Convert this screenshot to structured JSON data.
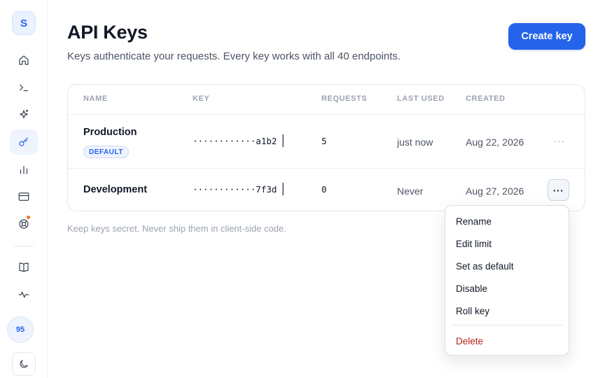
{
  "sidebar": {
    "avatar_initial": "S",
    "items": [
      {
        "icon": "home-icon"
      },
      {
        "icon": "terminal-icon"
      },
      {
        "icon": "sparkle-icon"
      },
      {
        "icon": "key-icon",
        "active": true
      },
      {
        "icon": "bar-chart-icon"
      },
      {
        "icon": "credit-card-icon"
      },
      {
        "icon": "support-lifebuoy-icon",
        "notification": true
      },
      {
        "icon": "book-icon"
      },
      {
        "icon": "activity-icon"
      }
    ],
    "score": "95",
    "theme_icon": "moon-icon"
  },
  "header": {
    "title": "API Keys",
    "subtitle": "Keys authenticate your requests. Every key works with all 40 endpoints.",
    "create_label": "Create key"
  },
  "table": {
    "columns": [
      "NAME",
      "KEY",
      "REQUESTS",
      "LAST USED",
      "CREATED"
    ],
    "rows": [
      {
        "name": "Production",
        "badge": "DEFAULT",
        "key": "············a1b2",
        "requests": "5",
        "last_used": "just now",
        "created": "Aug 22, 2026",
        "actions": "···"
      },
      {
        "name": "Development",
        "badge": "",
        "key": "············7f3d",
        "requests": "0",
        "last_used": "Never",
        "created": "Aug 27, 2026",
        "actions": "···"
      }
    ]
  },
  "footnote": "Keep keys secret. Never ship them in client-side code.",
  "menu": {
    "items": [
      "Rename",
      "Edit limit",
      "Set as default",
      "Disable",
      "Roll key"
    ],
    "danger": "Delete"
  },
  "colors": {
    "accent": "#2563eb",
    "danger": "#b42318",
    "notification": "#f97316"
  }
}
